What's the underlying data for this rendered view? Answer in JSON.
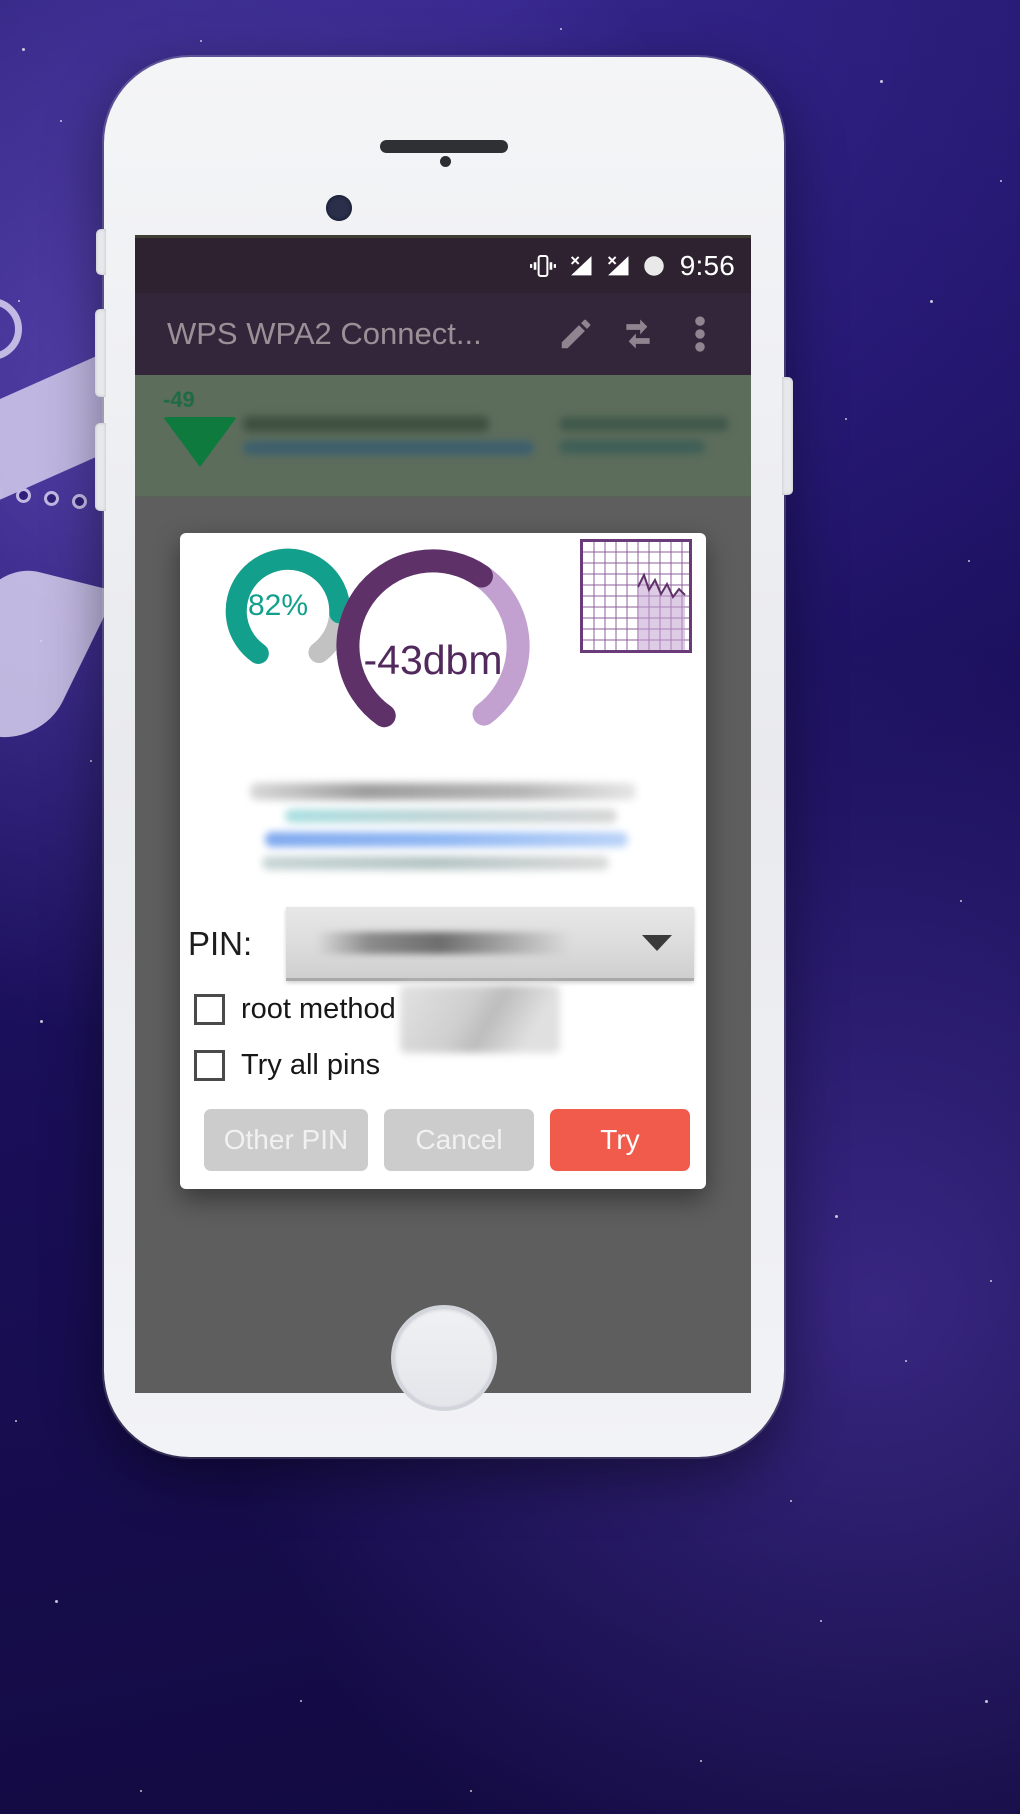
{
  "wallpaper": {
    "description": "dark purple starry space background with faint paper-plane artwork"
  },
  "device": {
    "type": "white smartphone mockup"
  },
  "status_bar": {
    "time": "9:56",
    "icons": [
      "vibrate-icon",
      "signal-no-service-icon",
      "signal-no-service-icon",
      "battery-circle-icon"
    ],
    "background": "#2e2231"
  },
  "app_bar": {
    "title": "WPS WPA2 Connect...",
    "actions": [
      "edit-icon",
      "refresh-icon",
      "overflow-menu-icon"
    ],
    "background": "#34263a",
    "title_color": "#9b9097"
  },
  "ap_list": {
    "rows": [
      {
        "rssi": "-49",
        "signal": "wifi-full-icon"
      }
    ]
  },
  "dialog": {
    "quality": {
      "value_label": "82%",
      "percent": 82,
      "color": "#12a08c",
      "track_color": "#c2c2c2"
    },
    "signal": {
      "value_label": "-43dbm",
      "dbm": -43,
      "percent": 62,
      "color": "#5e3268",
      "track_color": "#c2a0cf"
    },
    "chart_thumb": {
      "label": "spectrum-chart-thumbnail",
      "border_color": "#6b3a78"
    },
    "pin": {
      "label": "PIN:",
      "value": "",
      "placeholder": "",
      "caret": "chevron-down-icon"
    },
    "checkboxes": [
      {
        "label": "root method",
        "checked": false
      },
      {
        "label": "Try all pins",
        "checked": false
      }
    ],
    "buttons": [
      {
        "label": "Other PIN",
        "style": "grey"
      },
      {
        "label": "Cancel",
        "style": "grey"
      },
      {
        "label": "Try",
        "style": "primary"
      }
    ],
    "accent_color": "#f15b4b"
  },
  "chart_data": {
    "type": "line",
    "title": "spectrum-chart-thumbnail",
    "x": [
      0,
      1,
      2,
      3,
      4,
      5,
      6,
      7,
      8,
      9,
      10
    ],
    "values": [
      34,
      30,
      52,
      41,
      60,
      46,
      54,
      50,
      58,
      47,
      55
    ],
    "ylim": [
      0,
      80
    ],
    "xlabel": "",
    "ylabel": "",
    "grid": true,
    "legend": "none"
  }
}
